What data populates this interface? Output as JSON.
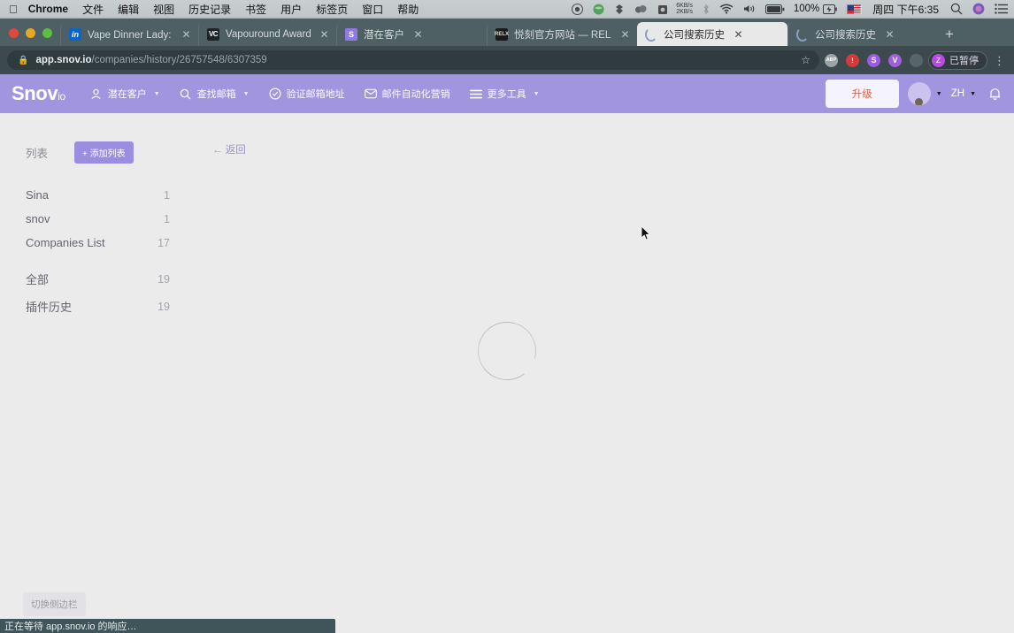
{
  "os_menubar": {
    "apple_icon": "apple-logo-icon",
    "items": [
      "Chrome",
      "文件",
      "编辑",
      "视图",
      "历史记录",
      "书签",
      "用户",
      "标签页",
      "窗口",
      "帮助"
    ],
    "status_icons": [
      "record-icon",
      "globe-icon",
      "dropbox-icon",
      "cloud-icon",
      "vault-icon"
    ],
    "network_up": "6KB/s",
    "network_down": "2KB/s",
    "bluetooth_icon": "bluetooth-icon",
    "wifi_icon": "wifi-icon",
    "volume_icon": "volume-icon",
    "battery_icon": "battery-icon",
    "battery_percent": "100%",
    "charging_icon": "charging-icon",
    "input_flag": "us-flag-icon",
    "clock": "周四 下午6:35",
    "search_icon": "spotlight-search-icon",
    "siri_icon": "siri-icon",
    "control_center_icon": "control-center-icon"
  },
  "browser": {
    "window_controls": [
      "close",
      "minimize",
      "maximize"
    ],
    "tabs": [
      {
        "title": "Vape Dinner Lady: 简介 | L",
        "favicon": "linkedin-icon",
        "favicon_text": "in",
        "active": false
      },
      {
        "title": "Vapouround Awards - VO",
        "favicon": "vapouround-icon",
        "favicon_text": "VC",
        "active": false
      },
      {
        "title": "潜在客户",
        "favicon": "snovio-icon",
        "favicon_text": "S",
        "active": false
      },
      {
        "title": "悦刻官方网站 — RELX Tec",
        "favicon": "relx-icon",
        "favicon_text": "RELX",
        "active": false
      },
      {
        "title": "公司搜索历史",
        "favicon": "loading-spinner-icon",
        "favicon_text": "",
        "active": true
      },
      {
        "title": "公司搜索历史",
        "favicon": "loading-spinner-icon",
        "favicon_text": "",
        "active": false
      }
    ],
    "new_tab_label": "+",
    "close_tab_label": "✕",
    "omnibox": {
      "lock_icon": "lock-icon",
      "host": "app.snov.io",
      "path": "/companies/history/26757548/6307359",
      "bookmark_icon": "star-icon"
    },
    "extensions": [
      {
        "name": "adblock-plus-extension",
        "label": "ABP"
      },
      {
        "name": "red-extension",
        "label": "!"
      },
      {
        "name": "snovio-extension",
        "label": "S"
      },
      {
        "name": "violet-extension",
        "label": "V"
      },
      {
        "name": "grey-extension",
        "label": ""
      }
    ],
    "profile": {
      "avatar_letter": "Z",
      "label": "已暂停"
    },
    "menu_icon": "chrome-menu-icon",
    "status_text": "正在等待 app.snov.io 的响应…"
  },
  "app": {
    "logo": "Snov",
    "logo_suffix": "io",
    "nav": [
      {
        "label": "潜在客户",
        "icon": "person-icon",
        "has_caret": true
      },
      {
        "label": "查找邮箱",
        "icon": "search-icon",
        "has_caret": true
      },
      {
        "label": "验证邮箱地址",
        "icon": "check-circle-icon",
        "has_caret": false
      },
      {
        "label": "邮件自动化营销",
        "icon": "envelope-icon",
        "has_caret": false
      },
      {
        "label": "更多工具",
        "icon": "menu-lines-icon",
        "has_caret": true
      }
    ],
    "upgrade_label": "升级",
    "avatar_icon": "user-avatar-icon",
    "language": "ZH",
    "bell_icon": "notification-bell-icon"
  },
  "sidebar": {
    "header_label": "列表",
    "add_list_label": "+ 添加列表",
    "back_label": "← 返回",
    "lists": [
      {
        "name": "Sina",
        "count": "1"
      },
      {
        "name": "snov",
        "count": "1"
      },
      {
        "name": "Companies List",
        "count": "17"
      }
    ],
    "groups": [
      {
        "name": "全部",
        "count": "19"
      },
      {
        "name": "插件历史",
        "count": "19"
      }
    ]
  },
  "main": {
    "loading_icon": "loading-spinner",
    "toggle_sidebar_label": "切换侧边栏"
  },
  "colors": {
    "app_header": "#a295e0",
    "accent_purple": "#9b8ee0",
    "upgrade_text": "#e8603c",
    "page_bg": "#ebebeb",
    "tabstrip": "#4e6064",
    "omnibox_bg": "#3c4a4e",
    "status_bubble": "#3f5559"
  }
}
